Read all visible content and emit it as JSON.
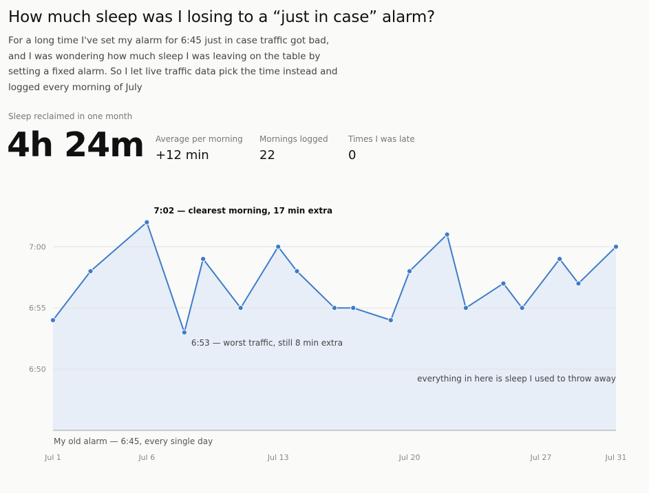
{
  "header": {
    "title": "How much sleep was I losing to a “just in case” alarm?",
    "intro": "For a long time I've set my alarm for 6:45 just in case traffic got bad, and I was wondering how much sleep I was leaving on the table by setting a fixed alarm. So I let live traffic data pick the time instead and logged every morning of July"
  },
  "summary": {
    "headline_label": "Sleep reclaimed in one month",
    "headline_value": "4h 24m",
    "stats": [
      {
        "label": "Average per morning",
        "value": "+12 min"
      },
      {
        "label": "Mornings logged",
        "value": "22"
      },
      {
        "label": "Times I was late",
        "value": "0"
      }
    ]
  },
  "colors": {
    "line": "#3d7cc9",
    "area": "#e7eef7",
    "grid": "#e2e2e2",
    "baseline": "#bdbdbd"
  },
  "chart_data": {
    "type": "area",
    "x_unit": "day of July",
    "y_unit": "alarm time (minutes after 6:00)",
    "x": [
      1,
      3,
      6,
      8,
      9,
      11,
      13,
      14,
      16,
      17,
      19,
      20,
      22,
      23,
      25,
      26,
      28,
      29,
      31
    ],
    "y_labels": [
      "6:54",
      "6:58",
      "7:02",
      "6:53",
      "6:59",
      "6:55",
      "7:00",
      "6:58",
      "6:55",
      "6:55",
      "6:54",
      "6:58",
      "7:01",
      "6:55",
      "6:57",
      "6:55",
      "6:59",
      "6:57",
      "7:00",
      "6:56",
      "6:56",
      "6:57"
    ],
    "series": [
      {
        "x": [
          1,
          2,
          3,
          4,
          5,
          6,
          7,
          8,
          9,
          10,
          11,
          12,
          13,
          14,
          15,
          16,
          17,
          18,
          19,
          20,
          21,
          22
        ],
        "values": [
          54,
          58,
          62,
          53,
          59,
          55,
          60,
          58,
          55,
          55,
          54,
          58,
          61,
          55,
          57,
          55,
          59,
          57,
          60,
          56,
          56,
          57
        ]
      }
    ],
    "xlim": [
      1,
      31
    ],
    "ylim": [
      45,
      63
    ],
    "yticks": [
      {
        "value": 50,
        "label": "6:50"
      },
      {
        "value": 55,
        "label": "6:55"
      },
      {
        "value": 60,
        "label": "7:00"
      }
    ],
    "xticks": [
      {
        "value": 1,
        "label": "Jul 1"
      },
      {
        "value": 6,
        "label": "Jul 6"
      },
      {
        "value": 13,
        "label": "Jul 13"
      },
      {
        "value": 20,
        "label": "Jul 20"
      },
      {
        "value": 27,
        "label": "Jul 27"
      },
      {
        "value": 31,
        "label": "Jul 31"
      }
    ],
    "baseline": {
      "value": 45,
      "label": "My old alarm — 6:45, every single day"
    },
    "annotations": [
      {
        "index": 2,
        "text": "7:02 — clearest morning, 17 min extra",
        "bold": true
      },
      {
        "index": 3,
        "text": "6:53 — worst traffic, still 8 min extra",
        "bold": false
      }
    ],
    "area_note": "everything in here is sleep I used to throw away",
    "grid": true
  }
}
